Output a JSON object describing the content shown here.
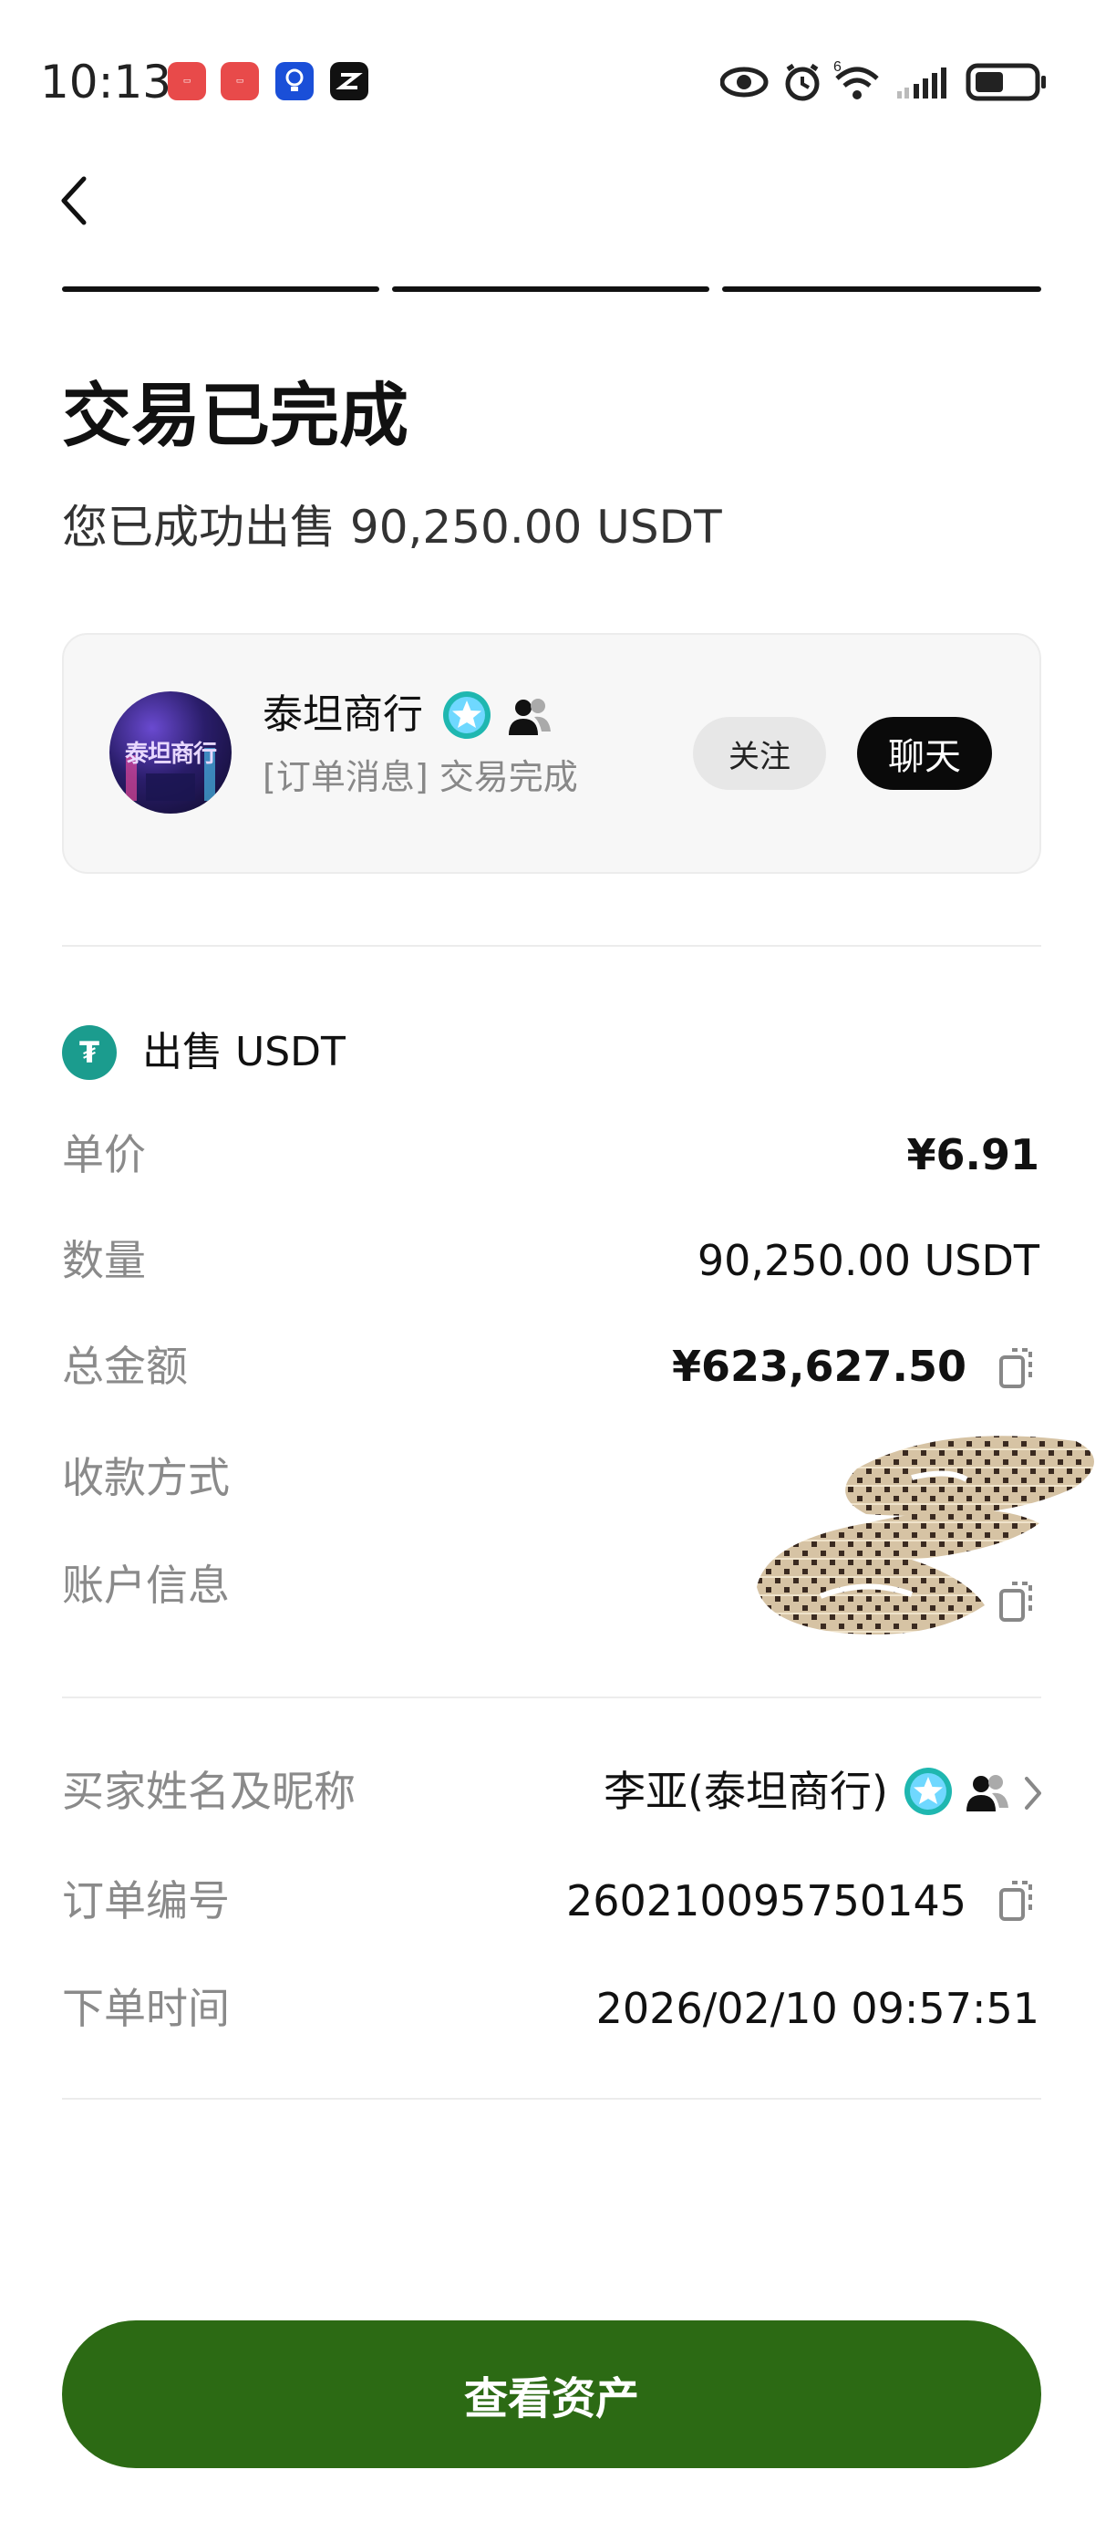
{
  "status_bar": {
    "time": "10:13",
    "notification_icons": [
      "huawei-app-icon",
      "huawei-app-icon",
      "bulb-app-icon",
      "capcut-app-icon"
    ],
    "right_icons": [
      "eye-icon",
      "alarm-icon",
      "wifi-icon",
      "signal-icon",
      "battery-icon"
    ],
    "wifi_badge": "6"
  },
  "nav": {
    "back_icon": "back-arrow-icon"
  },
  "progress": {
    "steps": 3,
    "completed": 3
  },
  "header": {
    "title": "交易已完成",
    "subtitle": "您已成功出售 90,250.00 USDT"
  },
  "merchant": {
    "name": "泰坦商行",
    "message": "[订单消息] 交易完成",
    "avatar_text": "泰坦商行",
    "follow_label": "关注",
    "chat_label": "聊天"
  },
  "order": {
    "section_title": "出售 USDT",
    "rows": [
      {
        "label": "单价",
        "value": "¥6.91"
      },
      {
        "label": "数量",
        "value": "90,250.00 USDT"
      },
      {
        "label": "总金额",
        "value": "¥623,627.50"
      },
      {
        "label": "收款方式",
        "value": ""
      },
      {
        "label": "账户信息",
        "value": ""
      }
    ]
  },
  "details": {
    "rows": [
      {
        "label": "买家姓名及昵称",
        "value": "李亚(泰坦商行)"
      },
      {
        "label": "订单编号",
        "value": "260210095750145"
      },
      {
        "label": "下单时间",
        "value": "2026/02/10 09:57:51"
      }
    ]
  },
  "cta": {
    "label": "查看资产"
  },
  "colors": {
    "primary_button": "#2c6a14",
    "chat_button": "#0a0a0a",
    "tether": "#1b9c8e",
    "label_gray": "#8a8a8a",
    "verified_badge": "#1fb7b0"
  }
}
